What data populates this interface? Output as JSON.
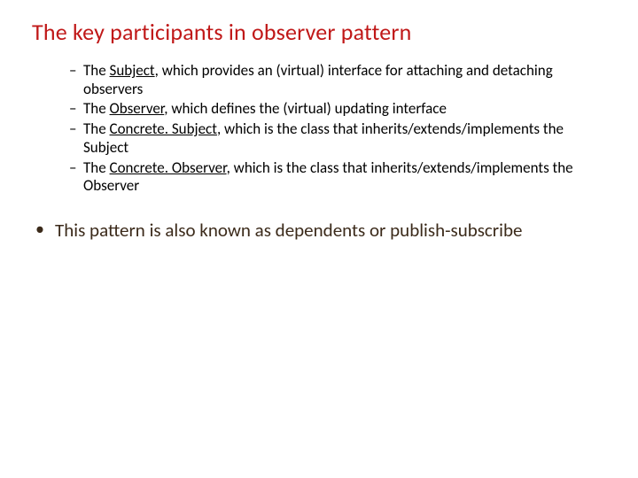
{
  "title": "The key participants in observer pattern",
  "items": [
    {
      "prefix": "The ",
      "term": "Subject",
      "rest": ", which provides an (virtual) interface for attaching and detaching observers"
    },
    {
      "prefix": "The ",
      "term": "Observer",
      "rest": ", which defines the (virtual) updating interface"
    },
    {
      "prefix": "The ",
      "term": "Concrete. Subject",
      "rest": ", which is the class that inherits/extends/implements the Subject"
    },
    {
      "prefix": "The ",
      "term": "Concrete. Observer",
      "rest": ", which is the class that inherits/extends/implements the Observer"
    }
  ],
  "footer": "This pattern is also known as dependents or publish-subscribe"
}
